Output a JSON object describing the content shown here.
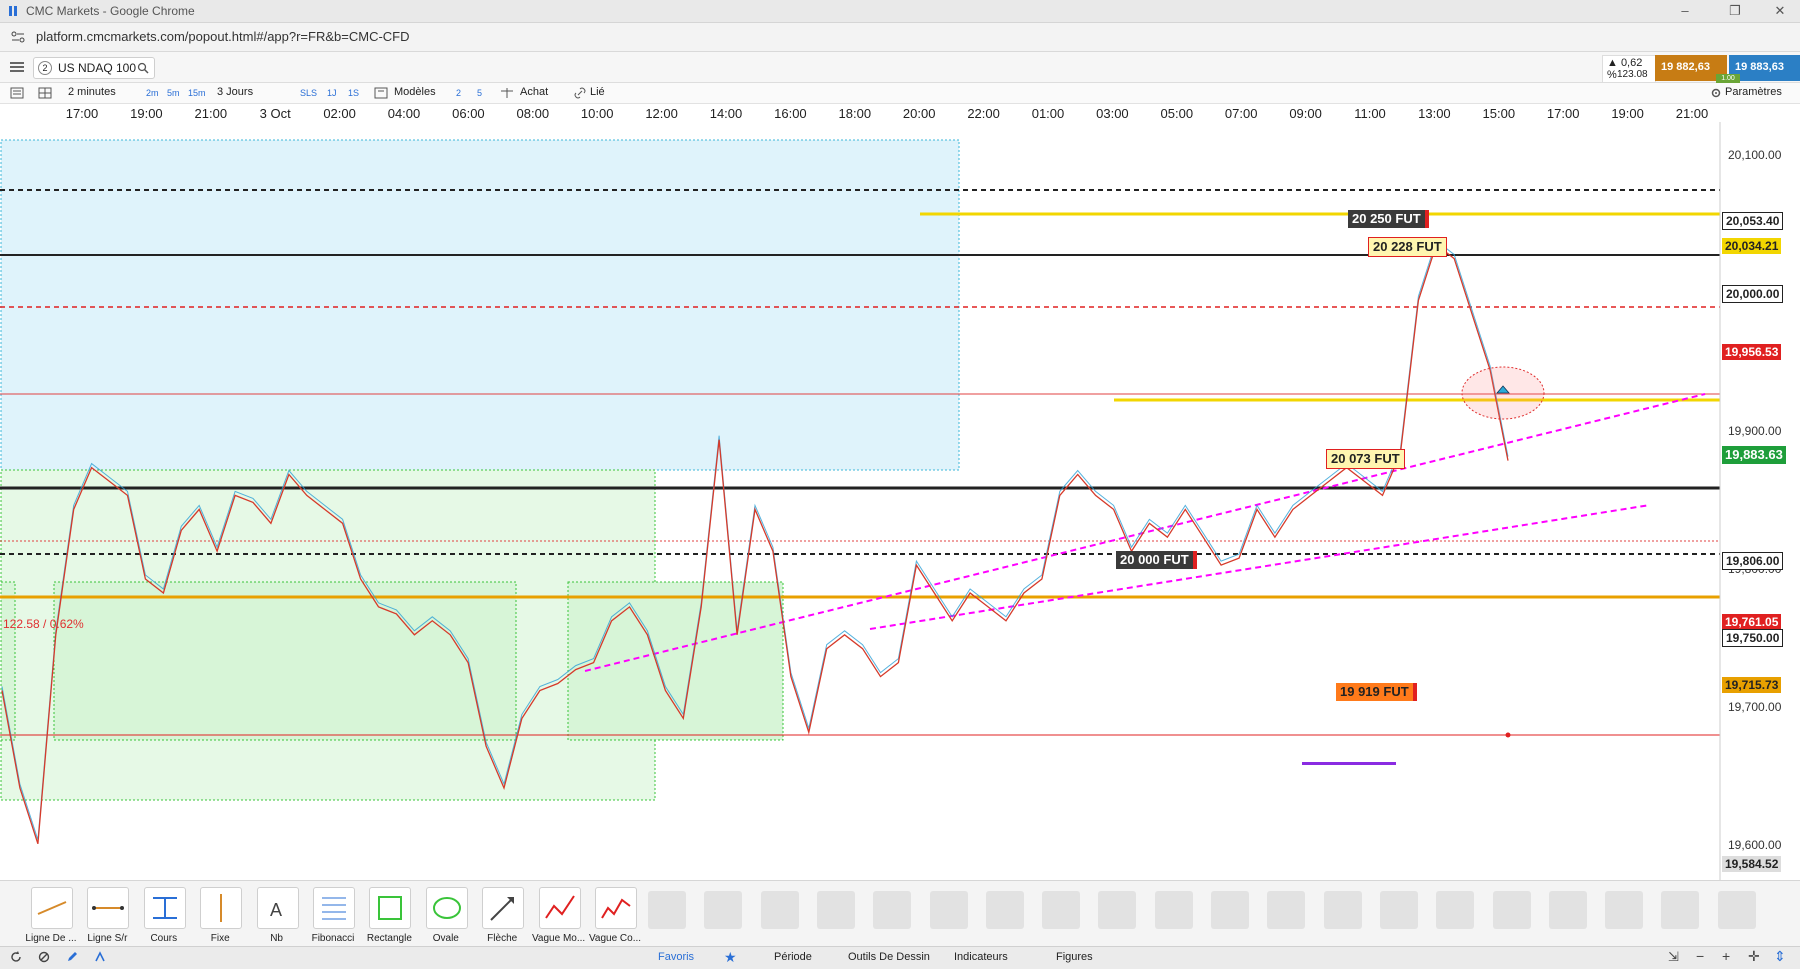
{
  "window": {
    "title": "CMC Markets - Google Chrome",
    "minimize": "–",
    "restore": "❐",
    "close": "✕"
  },
  "address": {
    "url": "platform.cmcmarkets.com/popout.html#/app?r=FR&b=CMC-CFD"
  },
  "instrument": {
    "badge": "2",
    "name": "US NDAQ 100",
    "change_pct": "▲ 0,62 %",
    "change_pts": "123.08",
    "sell": "19 882,63",
    "buy": "19 883,63",
    "spread": "1.00"
  },
  "toolbar": {
    "interval": "2 minutes",
    "quick_intervals": [
      "2m",
      "5m",
      "15m"
    ],
    "range": "3 Jours",
    "sls": "SLS",
    "d1": "1J",
    "s1": "1S",
    "models": "Modèles",
    "n2": "2",
    "n5": "5",
    "buy": "Achat",
    "linked": "Lié",
    "settings": "Paramètres"
  },
  "time_axis": [
    "17:00",
    "19:00",
    "21:00",
    "3 Oct",
    "02:00",
    "04:00",
    "06:00",
    "08:00",
    "10:00",
    "12:00",
    "14:00",
    "16:00",
    "18:00",
    "20:00",
    "22:00",
    "01:00",
    "03:00",
    "05:00",
    "07:00",
    "09:00",
    "11:00",
    "13:00",
    "15:00",
    "17:00",
    "19:00",
    "21:00"
  ],
  "price_axis": {
    "ticks": [
      "20,100.00",
      "19,900.00",
      "19,800.00",
      "19,700.00",
      "19,600.00"
    ],
    "boxes": {
      "p20053": "20,053.40",
      "p20034": "20,034.21",
      "p20000": "20,000.00",
      "p19956": "19,956.53",
      "current": "19,883.63",
      "p19806": "19,806.00",
      "p19761": "19,761.05",
      "p19750": "19,750.00",
      "p19715": "19,715.73",
      "p19584": "19,584.52"
    }
  },
  "chart_labels": {
    "fut20250": "20 250 FUT",
    "fut20228": "20 228 FUT",
    "fut20073": "20 073 FUT",
    "fut20000": "20 000 FUT",
    "fut19919": "19 919 FUT",
    "change": "122.58 / 0.62%"
  },
  "colors": {
    "accent_blue": "#2a6fd6",
    "up": "#2a9fd6",
    "down": "#d63a2a",
    "yellow_line": "#f2d600",
    "orange_line": "#e8a000",
    "magenta": "#ff00ff"
  },
  "tools": [
    {
      "label": "Ligne De ...",
      "icon": "line-tool-icon"
    },
    {
      "label": "Ligne S/r",
      "icon": "support-resistance-icon"
    },
    {
      "label": "Cours",
      "icon": "price-tool-icon"
    },
    {
      "label": "Fixe",
      "icon": "fixed-tool-icon"
    },
    {
      "label": "Nb",
      "icon": "note-tool-icon"
    },
    {
      "label": "Fibonacci",
      "icon": "fibonacci-icon"
    },
    {
      "label": "Rectangle",
      "icon": "rectangle-icon"
    },
    {
      "label": "Ovale",
      "icon": "oval-icon"
    },
    {
      "label": "Flèche",
      "icon": "arrow-tool-icon"
    },
    {
      "label": "Vague Mo...",
      "icon": "wave-motion-icon"
    },
    {
      "label": "Vague Co...",
      "icon": "wave-correction-icon"
    }
  ],
  "bottom_tabs": {
    "favorites": "Favoris",
    "period": "Période",
    "drawing": "Outils De Dessin",
    "indicators": "Indicateurs",
    "figures": "Figures"
  },
  "chart_data": {
    "type": "line",
    "title": "",
    "xlabel": "",
    "ylabel": "",
    "ylim": [
      19584,
      20128
    ],
    "series": [
      {
        "values": [
          19720,
          19650,
          19610,
          19760,
          19850,
          19880,
          19870,
          19860,
          19800,
          19790,
          19835,
          19850,
          19820,
          19860,
          19855,
          19840,
          19875,
          19860,
          19850,
          19840,
          19800,
          19780,
          19775,
          19760,
          19770,
          19760,
          19740,
          19680,
          19650,
          19700,
          19720,
          19725,
          19735,
          19740,
          19770,
          19780,
          19760,
          19720,
          19700,
          19780,
          19900,
          19760,
          19850,
          19820,
          19730,
          19690,
          19750,
          19760,
          19750,
          19730,
          19740,
          19810,
          19790,
          19770,
          19790,
          19780,
          19770,
          19790,
          19800,
          19860,
          19875,
          19860,
          19850,
          19820,
          19840,
          19830,
          19850,
          19830,
          19810,
          19815,
          19850,
          19830,
          19850,
          19860,
          19870,
          19880,
          19870,
          19860,
          19890,
          20000,
          20040,
          20030,
          19990,
          19950,
          19885
        ]
      }
    ]
  }
}
